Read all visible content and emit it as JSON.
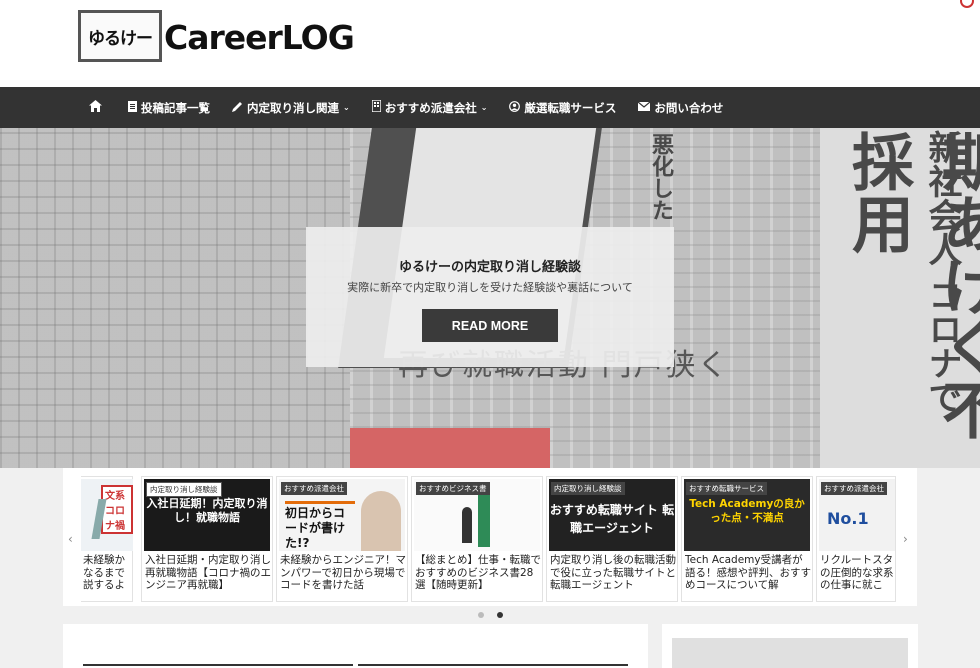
{
  "header": {
    "logo_mark": "ゆるけー",
    "logo_text": "CareerLOG"
  },
  "nav": {
    "items": [
      {
        "label": "",
        "icon": "home-icon",
        "dropdown": false
      },
      {
        "label": "投稿記事一覧",
        "icon": "document-icon",
        "dropdown": false
      },
      {
        "label": "内定取り消し関連",
        "icon": "pencil-icon",
        "dropdown": true
      },
      {
        "label": "おすすめ派遣会社",
        "icon": "building-icon",
        "dropdown": true
      },
      {
        "label": "厳選転職サービス",
        "icon": "user-circle-icon",
        "dropdown": false
      },
      {
        "label": "お問い合わせ",
        "icon": "envelope-icon",
        "dropdown": false
      }
    ]
  },
  "hero": {
    "title": "ゆるけーの内定取り消し経験談",
    "subtitle": "実際に新卒で内定取り消しを受けた経験談や裏話について",
    "button": "READ MORE",
    "headline_1": "新社会人 コロナで",
    "headline_2": "期あげく不採用",
    "headline_3": "再び就職活動 門戸狭く",
    "headline_4": "悪化した"
  },
  "carousel": {
    "cards": [
      {
        "category": "",
        "thumb_title": "文系 コロナ禍",
        "text": "未経験かなるまで説するよ"
      },
      {
        "category": "内定取り消し経験談",
        "thumb_title": "入社日延期！内定取り消し！就職物語",
        "text": "入社日延期・内定取り消し再就職物語【コロナ禍のエンジニア再就職】"
      },
      {
        "category": "おすすめ派遣会社",
        "thumb_title": "初日からコードが書けた!?",
        "text": "未経験からエンジニア！マンパワーで初日から現場でコードを書けた話"
      },
      {
        "category": "おすすめビジネス書",
        "thumb_title": "",
        "text": "【総まとめ】仕事・転職でおすすめのビジネス書28選【随時更新】"
      },
      {
        "category": "内定取り消し経験談",
        "thumb_title": "おすすめ転職サイト 転職エージェント",
        "text": "内定取り消し後の転職活動で役に立った転職サイトと転職エージェント"
      },
      {
        "category": "おすすめ転職サービス",
        "thumb_title": "Tech Academyの良かった点・不満点",
        "text": "Tech Academy受講者が語る！感想や評判、おすすめコースについて解"
      },
      {
        "category": "おすすめ派遣会社",
        "thumb_title": "No.1",
        "text": "リクルートスタの圧倒的な求系の仕事に就こ"
      }
    ]
  },
  "colors": {
    "nav_bg": "#333333",
    "button_bg": "#3a3a3a",
    "accent_red": "#cc3333"
  }
}
